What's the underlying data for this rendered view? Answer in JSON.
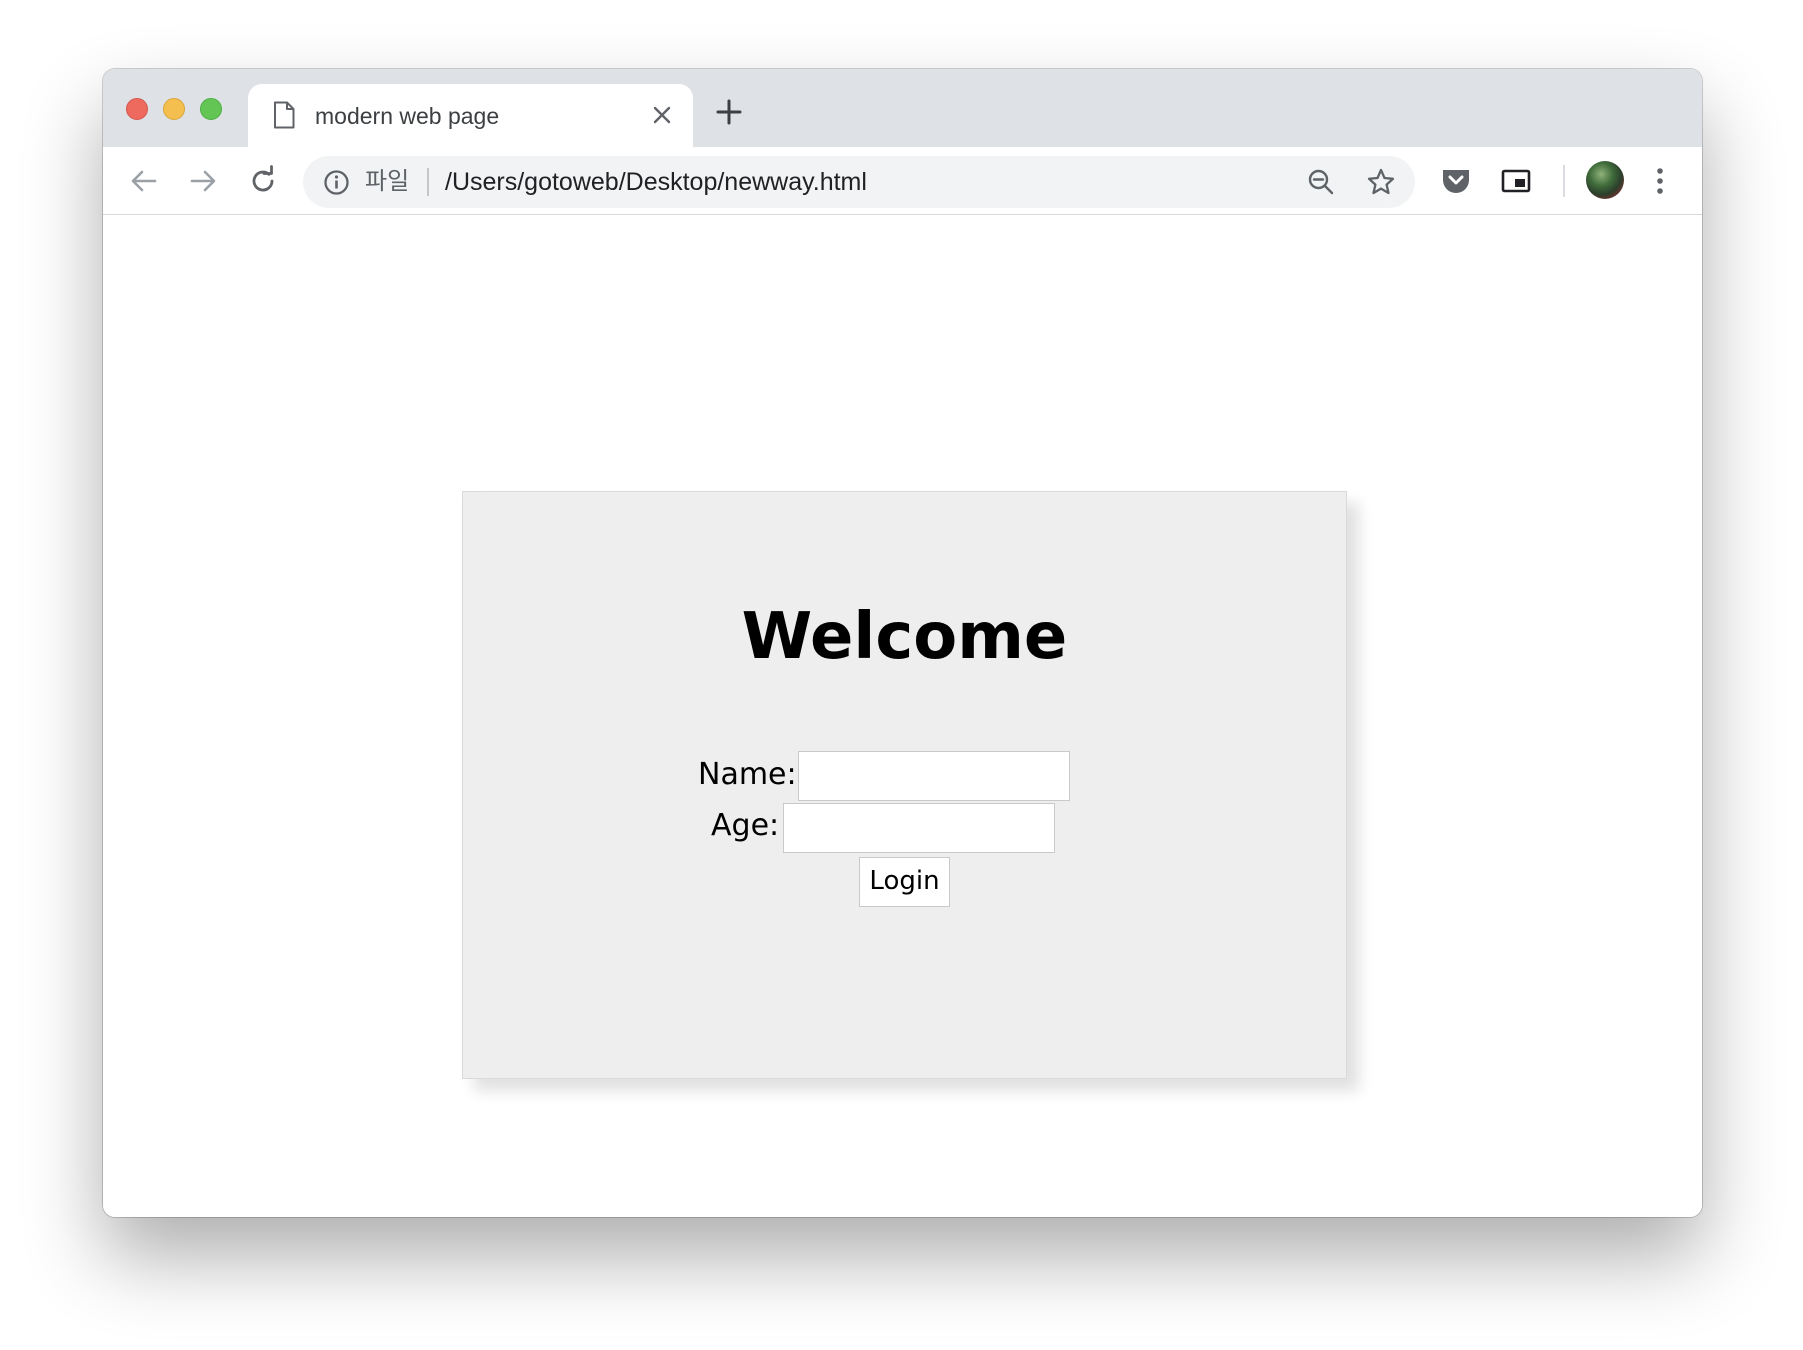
{
  "browser": {
    "tab": {
      "title": "modern web page",
      "icon": "document-icon"
    },
    "omnibox": {
      "scheme_label": "파일",
      "url": "/Users/gotoweb/Desktop/newway.html"
    },
    "icons": [
      "back-icon",
      "forward-icon",
      "reload-icon",
      "info-icon",
      "zoom-out-icon",
      "star-icon",
      "pocket-icon",
      "picture-in-picture-icon",
      "avatar",
      "kebab-menu-icon"
    ]
  },
  "page": {
    "heading": "Welcome",
    "form": {
      "name_label": "Name:",
      "name_value": "",
      "age_label": "Age:",
      "age_value": "",
      "submit_label": "Login"
    }
  },
  "colors": {
    "close": "#ee6a5f",
    "minimize": "#f5bf4f",
    "maximize": "#62c554",
    "card_background": "#eeeeee",
    "tabstrip": "#dee1e6"
  }
}
